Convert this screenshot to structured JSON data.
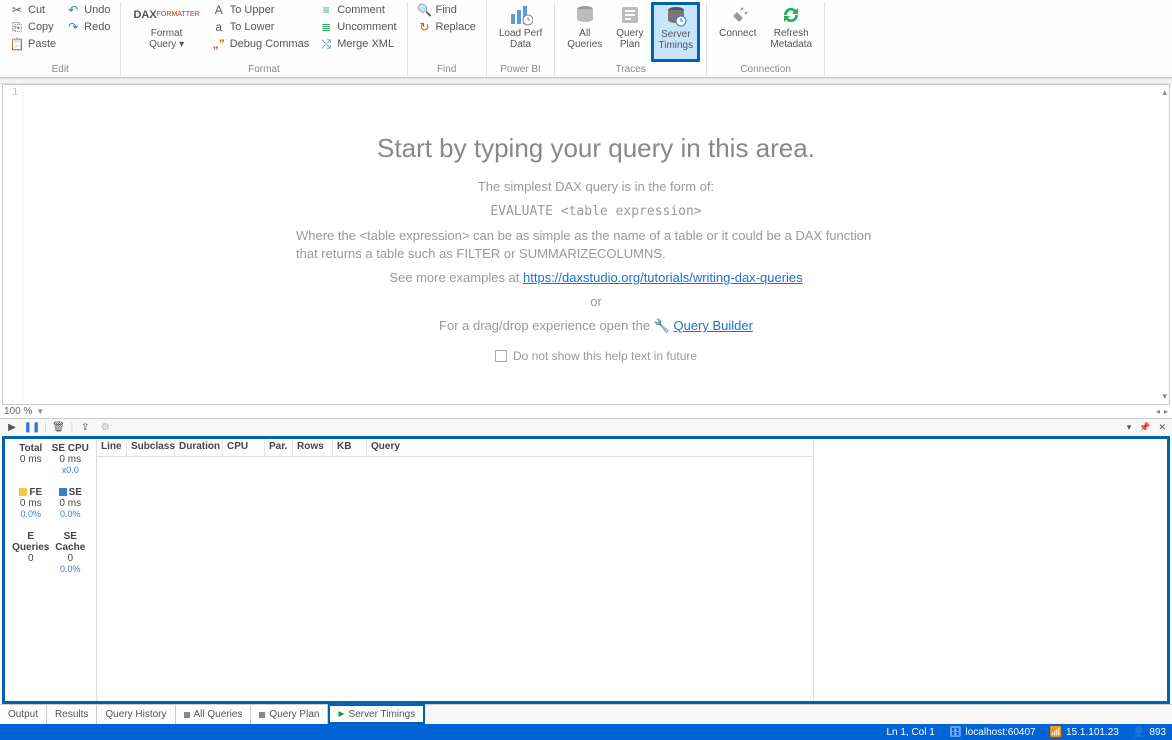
{
  "ribbon": {
    "edit": {
      "cut": "Cut",
      "copy": "Copy",
      "paste": "Paste",
      "undo": "Undo",
      "redo": "Redo",
      "group_label": "Edit"
    },
    "format": {
      "dax_label": "Format\nQuery",
      "to_upper": "To Upper",
      "to_lower": "To Lower",
      "debug_commas": "Debug Commas",
      "comment": "Comment",
      "uncomment": "Uncomment",
      "merge_xml": "Merge XML",
      "group_label": "Format"
    },
    "find": {
      "find": "Find",
      "replace": "Replace",
      "group_label": "Find"
    },
    "powerbi": {
      "load_perf": "Load Perf\nData",
      "group_label": "Power BI"
    },
    "traces": {
      "all_queries": "All\nQueries",
      "query_plan": "Query\nPlan",
      "server_timings": "Server\nTimings",
      "group_label": "Traces"
    },
    "connection": {
      "connect": "Connect",
      "refresh": "Refresh\nMetadata",
      "group_label": "Connection"
    }
  },
  "editor": {
    "line_number": "1",
    "heading": "Start by typing your query in this area.",
    "p1": "The simplest DAX query is in the form of:",
    "code": "EVALUATE <table expression>",
    "p2": "Where the <table expression> can be as simple as the name of a table or it could be a DAX function that returns a table such as FILTER or SUMMARIZECOLUMNS.",
    "p3_prefix": "See more examples at ",
    "p3_link": "https://daxstudio.org/tutorials/writing-dax-queries",
    "or": "or",
    "p4_prefix": "For a drag/drop experience open the ",
    "p4_link": "Query Builder",
    "checkbox_label": "Do not show this help text in future",
    "zoom": "100 %"
  },
  "metrics": {
    "total_label": "Total",
    "total_val": "0 ms",
    "se_cpu_label": "SE CPU",
    "se_cpu_val": "0 ms",
    "se_cpu_sub": "x0.0",
    "fe_label": "FE",
    "fe_val": "0 ms",
    "fe_pct": "0.0%",
    "se_label": "SE",
    "se_val": "0 ms",
    "se_pct": "0.0%",
    "eq_label": "E Queries",
    "eq_val": "0",
    "cache_label": "SE Cache",
    "cache_val": "0",
    "cache_pct": "0.0%"
  },
  "grid_headers": [
    "Line",
    "Subclass",
    "Duration",
    "CPU",
    "Par.",
    "Rows",
    "KB",
    "Query"
  ],
  "tabs": {
    "output": "Output",
    "results": "Results",
    "history": "Query History",
    "all_queries": "All Queries",
    "query_plan": "Query Plan",
    "server_timings": "Server Timings"
  },
  "status": {
    "position": "Ln 1, Col 1",
    "server": "localhost:60407",
    "version": "15.1.101.23",
    "count": "893"
  }
}
